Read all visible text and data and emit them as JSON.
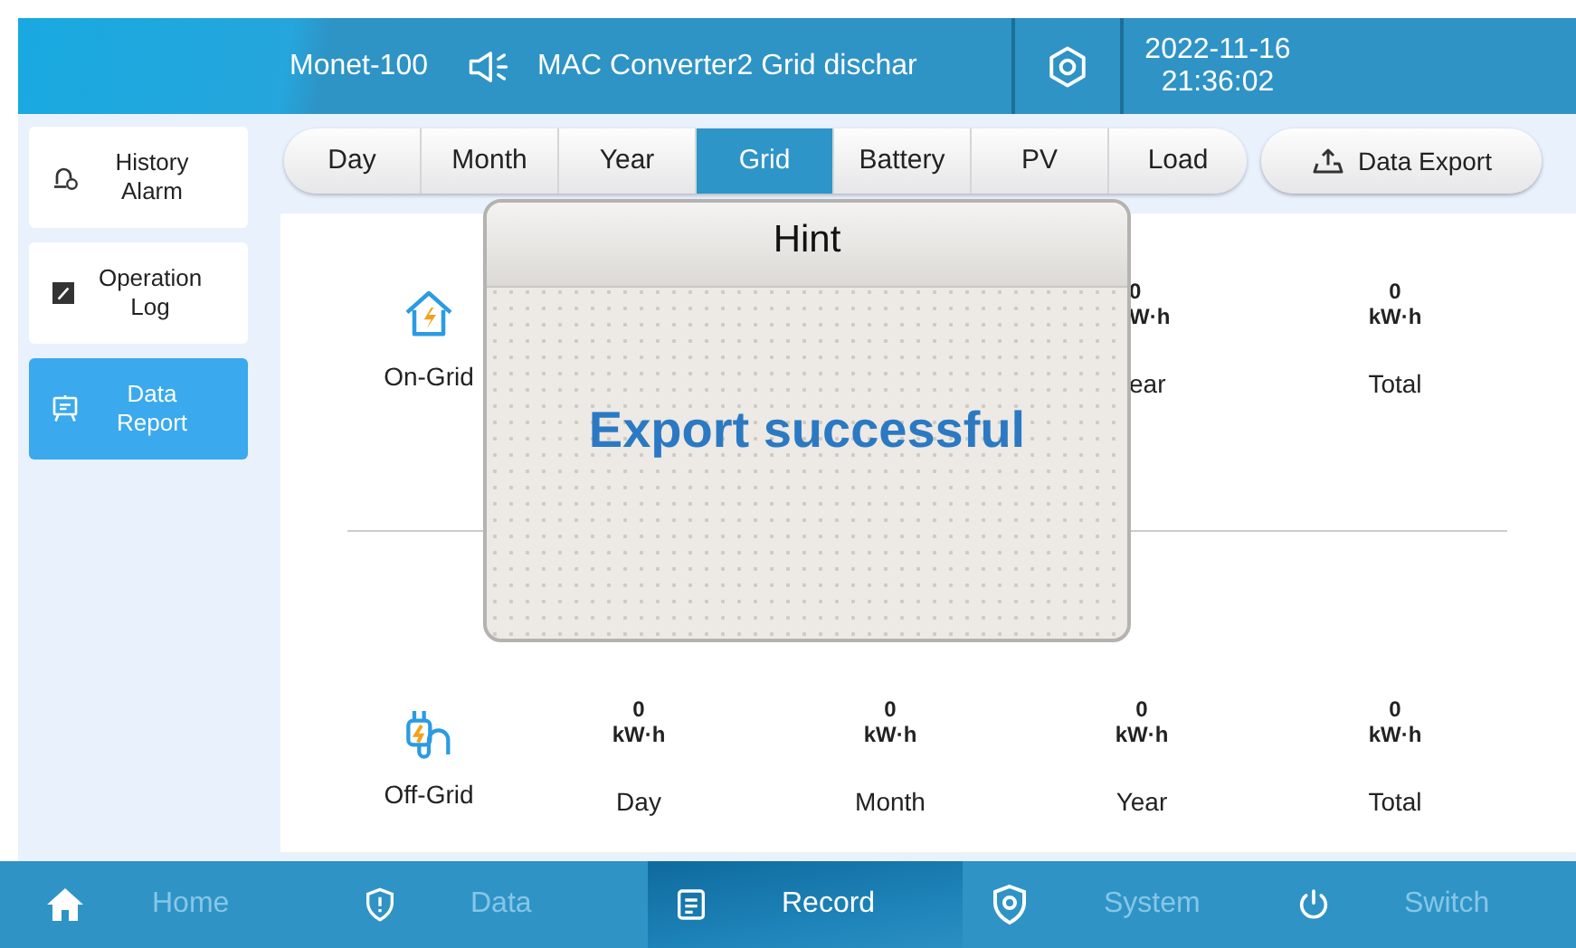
{
  "header": {
    "title": "Monet-100",
    "alarm_message": "MAC Converter2 Grid dischar",
    "date": "2022-11-16",
    "time": "21:36:02"
  },
  "sidebar": [
    {
      "label": "History Alarm",
      "selected": false
    },
    {
      "label": "Operation Log",
      "selected": false
    },
    {
      "label": "Data Report",
      "selected": true
    }
  ],
  "tabs": [
    {
      "label": "Day",
      "selected": false
    },
    {
      "label": "Month",
      "selected": false
    },
    {
      "label": "Year",
      "selected": false
    },
    {
      "label": "Grid",
      "selected": true
    },
    {
      "label": "Battery",
      "selected": false
    },
    {
      "label": "PV",
      "selected": false
    },
    {
      "label": "Load",
      "selected": false
    }
  ],
  "export_button": "Data Export",
  "rows": [
    {
      "label": "On-Grid",
      "cells": [
        {
          "kind": "clipped",
          "value": "0",
          "unit": "W·h",
          "label": "ear"
        },
        {
          "kind": "full",
          "value": "0",
          "unit": "kW·h",
          "label": "Total"
        }
      ]
    },
    {
      "label": "Off-Grid",
      "cells": [
        {
          "kind": "full",
          "value": "0",
          "unit": "kW·h",
          "label": "Day"
        },
        {
          "kind": "full",
          "value": "0",
          "unit": "kW·h",
          "label": "Month"
        },
        {
          "kind": "full",
          "value": "0",
          "unit": "kW·h",
          "label": "Year"
        },
        {
          "kind": "full",
          "value": "0",
          "unit": "kW·h",
          "label": "Total"
        }
      ]
    }
  ],
  "dialog": {
    "title": "Hint",
    "message": "Export successful"
  },
  "bottom_nav": [
    {
      "label": "Home",
      "selected": false
    },
    {
      "label": "Data",
      "selected": false
    },
    {
      "label": "Record",
      "selected": true
    },
    {
      "label": "System",
      "selected": false
    },
    {
      "label": "Switch",
      "selected": false
    }
  ]
}
